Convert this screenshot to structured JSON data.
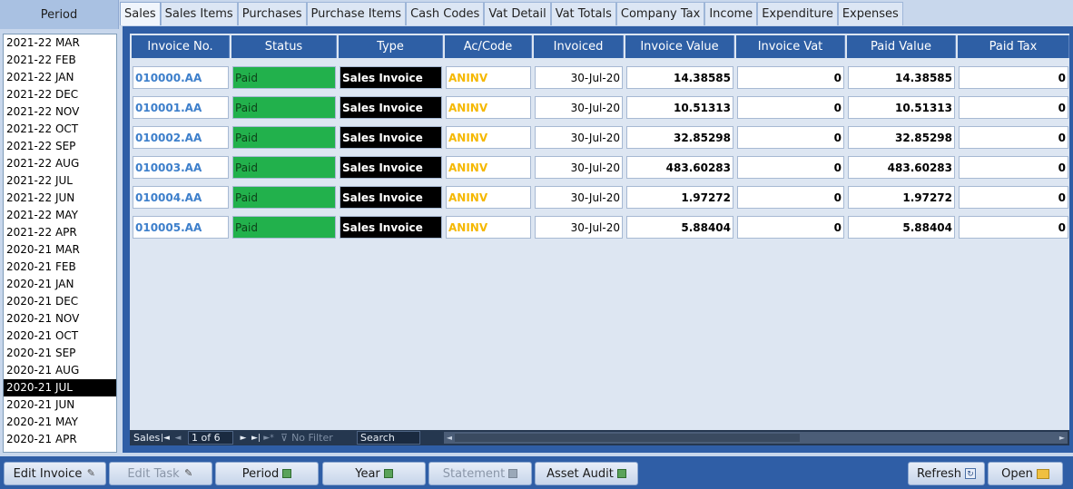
{
  "period_panel": {
    "header": "Period",
    "items": [
      "2021-22 MAR",
      "2021-22 FEB",
      "2021-22 JAN",
      "2021-22 DEC",
      "2021-22 NOV",
      "2021-22 OCT",
      "2021-22 SEP",
      "2021-22 AUG",
      "2021-22 JUL",
      "2021-22 JUN",
      "2021-22 MAY",
      "2021-22 APR",
      "2020-21 MAR",
      "2020-21 FEB",
      "2020-21 JAN",
      "2020-21 DEC",
      "2020-21 NOV",
      "2020-21 OCT",
      "2020-21 SEP",
      "2020-21 AUG",
      "2020-21 JUL",
      "2020-21 JUN",
      "2020-21 MAY",
      "2020-21 APR"
    ],
    "selected": "2020-21 JUL"
  },
  "tabs": [
    "Sales",
    "Sales Items",
    "Purchases",
    "Purchase Items",
    "Cash Codes",
    "Vat Detail",
    "Vat Totals",
    "Company Tax",
    "Income",
    "Expenditure",
    "Expenses"
  ],
  "active_tab": "Sales",
  "columns": [
    "Invoice No.",
    "Status",
    "Type",
    "Ac/Code",
    "Invoiced",
    "Invoice Value",
    "Invoice Vat",
    "Paid Value",
    "Paid Tax"
  ],
  "rows": [
    {
      "invoice_no": "010000.AA",
      "status": "Paid",
      "type": "Sales Invoice",
      "ac_code": "ANINV",
      "invoiced": "30-Jul-20",
      "invoice_value": "14.38585",
      "invoice_vat": "0",
      "paid_value": "14.38585",
      "paid_tax": "0"
    },
    {
      "invoice_no": "010001.AA",
      "status": "Paid",
      "type": "Sales Invoice",
      "ac_code": "ANINV",
      "invoiced": "30-Jul-20",
      "invoice_value": "10.51313",
      "invoice_vat": "0",
      "paid_value": "10.51313",
      "paid_tax": "0"
    },
    {
      "invoice_no": "010002.AA",
      "status": "Paid",
      "type": "Sales Invoice",
      "ac_code": "ANINV",
      "invoiced": "30-Jul-20",
      "invoice_value": "32.85298",
      "invoice_vat": "0",
      "paid_value": "32.85298",
      "paid_tax": "0"
    },
    {
      "invoice_no": "010003.AA",
      "status": "Paid",
      "type": "Sales Invoice",
      "ac_code": "ANINV",
      "invoiced": "30-Jul-20",
      "invoice_value": "483.60283",
      "invoice_vat": "0",
      "paid_value": "483.60283",
      "paid_tax": "0"
    },
    {
      "invoice_no": "010004.AA",
      "status": "Paid",
      "type": "Sales Invoice",
      "ac_code": "ANINV",
      "invoiced": "30-Jul-20",
      "invoice_value": "1.97272",
      "invoice_vat": "0",
      "paid_value": "1.97272",
      "paid_tax": "0"
    },
    {
      "invoice_no": "010005.AA",
      "status": "Paid",
      "type": "Sales Invoice",
      "ac_code": "ANINV",
      "invoiced": "30-Jul-20",
      "invoice_value": "5.88404",
      "invoice_vat": "0",
      "paid_value": "5.88404",
      "paid_tax": "0"
    }
  ],
  "navigator": {
    "label": "Sales",
    "position": "1 of 6",
    "filter": "No Filter",
    "search": "Search"
  },
  "buttons": {
    "edit_invoice": "Edit Invoice",
    "edit_task": "Edit Task",
    "period": "Period",
    "year": "Year",
    "statement": "Statement",
    "asset_audit": "Asset Audit",
    "refresh": "Refresh",
    "open": "Open"
  },
  "colors": {
    "paid": "#22b14c",
    "type_bg": "#000000",
    "ac_code": "#f5b800",
    "invoice_link": "#3d7fcb",
    "header_blue": "#2e5fa5"
  }
}
